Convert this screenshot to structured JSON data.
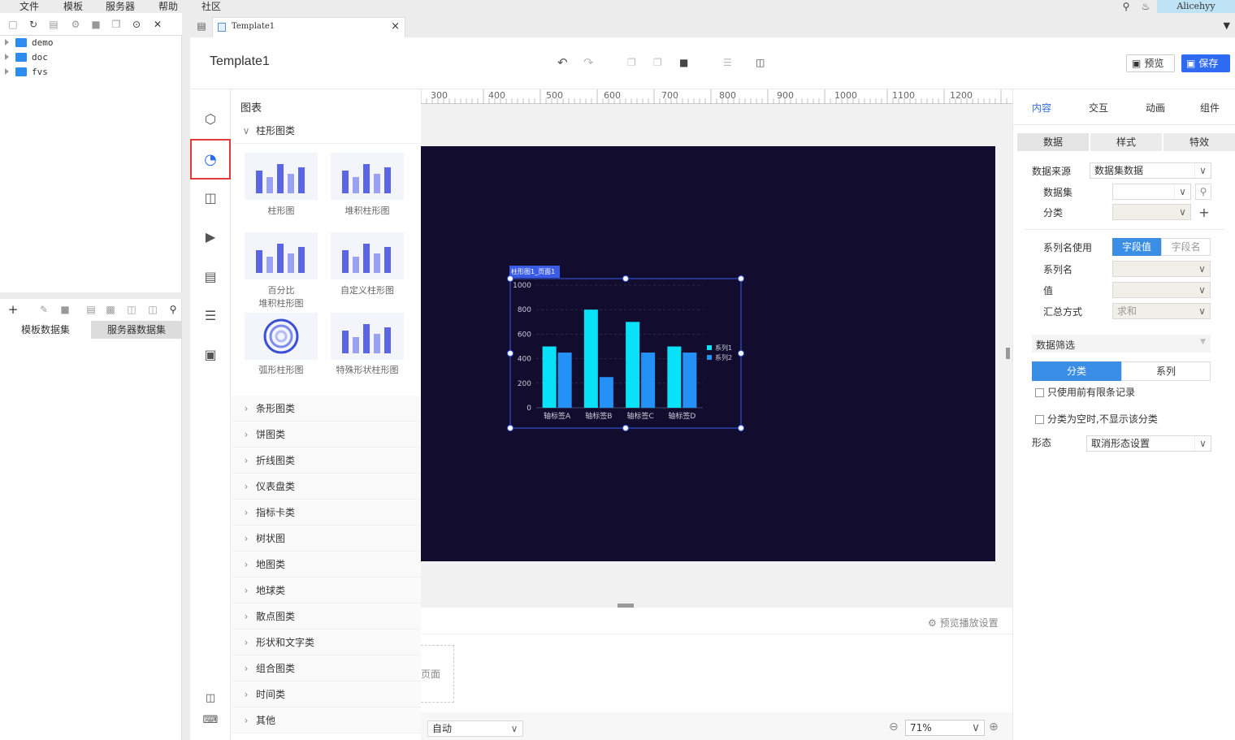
{
  "menu": [
    "文件",
    "模板",
    "服务器",
    "帮助",
    "社区"
  ],
  "user": "Alicehyy",
  "tree": [
    "demo",
    "doc",
    "fvs"
  ],
  "datasets": {
    "tab_template": "模板数据集",
    "tab_server": "服务器数据集"
  },
  "doc_tab": "Template1",
  "header": {
    "title": "Template1",
    "preview": "预览",
    "save": "保存"
  },
  "panel": {
    "title": "图表",
    "open_section": "柱形图类",
    "thumbs": [
      {
        "l1": "柱形图",
        "l2": ""
      },
      {
        "l1": "堆积柱形图",
        "l2": ""
      },
      {
        "l1": "百分比",
        "l2": "堆积柱形图"
      },
      {
        "l1": "自定义柱形图",
        "l2": ""
      },
      {
        "l1": "弧形柱形图",
        "l2": ""
      },
      {
        "l1": "特殊形状柱形图",
        "l2": ""
      }
    ],
    "sections": [
      "条形图类",
      "饼图类",
      "折线图类",
      "仪表盘类",
      "指标卡类",
      "树状图",
      "地图类",
      "地球类",
      "散点图类",
      "形状和文字类",
      "组合图类",
      "时间类",
      "其他"
    ]
  },
  "ruler_ticks": [
    "300",
    "400",
    "500",
    "600",
    "700",
    "800",
    "900",
    "1000",
    "1100",
    "1200"
  ],
  "widget_label": "柱形图1_页面1",
  "chart_data": {
    "type": "bar",
    "categories": [
      "轴标签A",
      "轴标签B",
      "轴标签C",
      "轴标签D"
    ],
    "series": [
      {
        "name": "系列1",
        "values": [
          500,
          800,
          700,
          500
        ],
        "color": "#08e1f8"
      },
      {
        "name": "系列2",
        "values": [
          450,
          250,
          450,
          450
        ],
        "color": "#2491f7"
      }
    ],
    "ylim": [
      0,
      1000
    ],
    "yticks": [
      "0",
      "200",
      "400",
      "600",
      "800",
      "1000"
    ],
    "legend": "right"
  },
  "bottom": {
    "playback": "预览播放设置",
    "page": "页面",
    "auto": "自动",
    "zoom": "71%"
  },
  "right": {
    "tabs": [
      "内容",
      "交互",
      "动画",
      "组件"
    ],
    "subtabs": [
      "数据",
      "样式",
      "特效"
    ],
    "datasource_label": "数据来源",
    "datasource_value": "数据集数据",
    "dataset_label": "数据集",
    "category_label": "分类",
    "series_name_use": "系列名使用",
    "field_value": "字段值",
    "field_name": "字段名",
    "series_name": "系列名",
    "value": "值",
    "agg_label": "汇总方式",
    "agg_value": "求和",
    "filter": "数据筛选",
    "filter_cat": "分类",
    "filter_series": "系列",
    "opt_limit": "只使用前有限条记录",
    "opt_empty": "分类为空时,不显示该分类",
    "shape_label": "形态",
    "shape_value": "取消形态设置"
  }
}
